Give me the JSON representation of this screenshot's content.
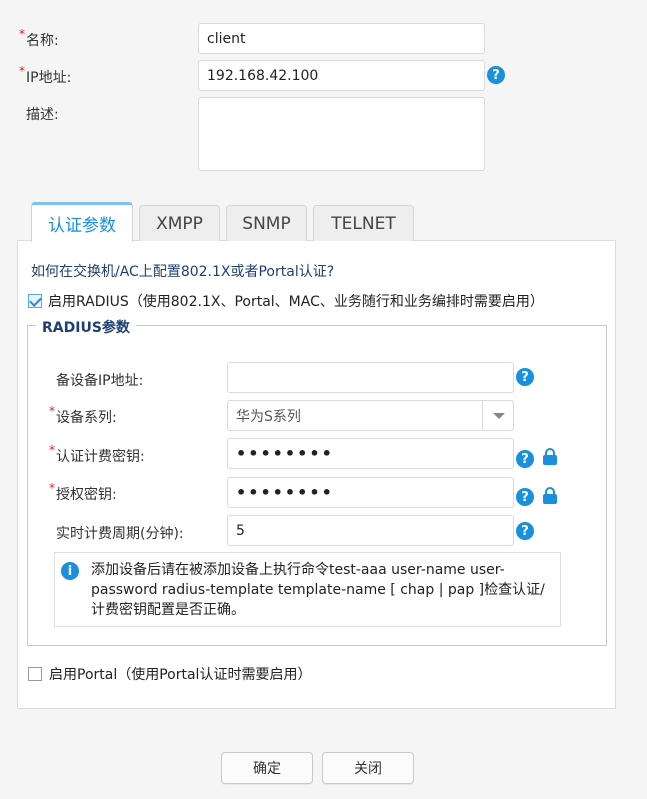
{
  "form": {
    "name_label": "名称:",
    "name_value": "client",
    "ip_label": "IP地址:",
    "ip_value": "192.168.42.100",
    "desc_label": "描述:",
    "desc_value": ""
  },
  "tabs": [
    {
      "label": "认证参数",
      "active": true
    },
    {
      "label": "XMPP",
      "active": false
    },
    {
      "label": "SNMP",
      "active": false
    },
    {
      "label": "TELNET",
      "active": false
    }
  ],
  "auth": {
    "help_link": "如何在交换机/AC上配置802.1X或者Portal认证?",
    "radius_checkbox_label": "启用RADIUS（使用802.1X、Portal、MAC、业务随行和业务编排时需要启用）",
    "radius_checked": true,
    "radius_legend": "RADIUS参数",
    "backup_ip_label": "备设备IP地址:",
    "backup_ip_value": "",
    "device_series_label": "设备系列:",
    "device_series_value": "华为S系列",
    "auth_key_label": "认证计费密钥:",
    "auth_key_value": "••••••••",
    "authz_key_label": "授权密钥:",
    "authz_key_value": "••••••••",
    "period_label": "实时计费周期(分钟):",
    "period_value": "5",
    "info_text": "添加设备后请在被添加设备上执行命令test-aaa user-name user-password radius-template template-name [ chap | pap ]检查认证/计费密钥配置是否正确。",
    "portal_checkbox_label": "启用Portal（使用Portal认证时需要启用）",
    "portal_checked": false
  },
  "buttons": {
    "ok": "确定",
    "close": "关闭"
  },
  "colors": {
    "accent": "#1a8fdd",
    "required": "#e02020",
    "legend": "#1f3f73"
  }
}
